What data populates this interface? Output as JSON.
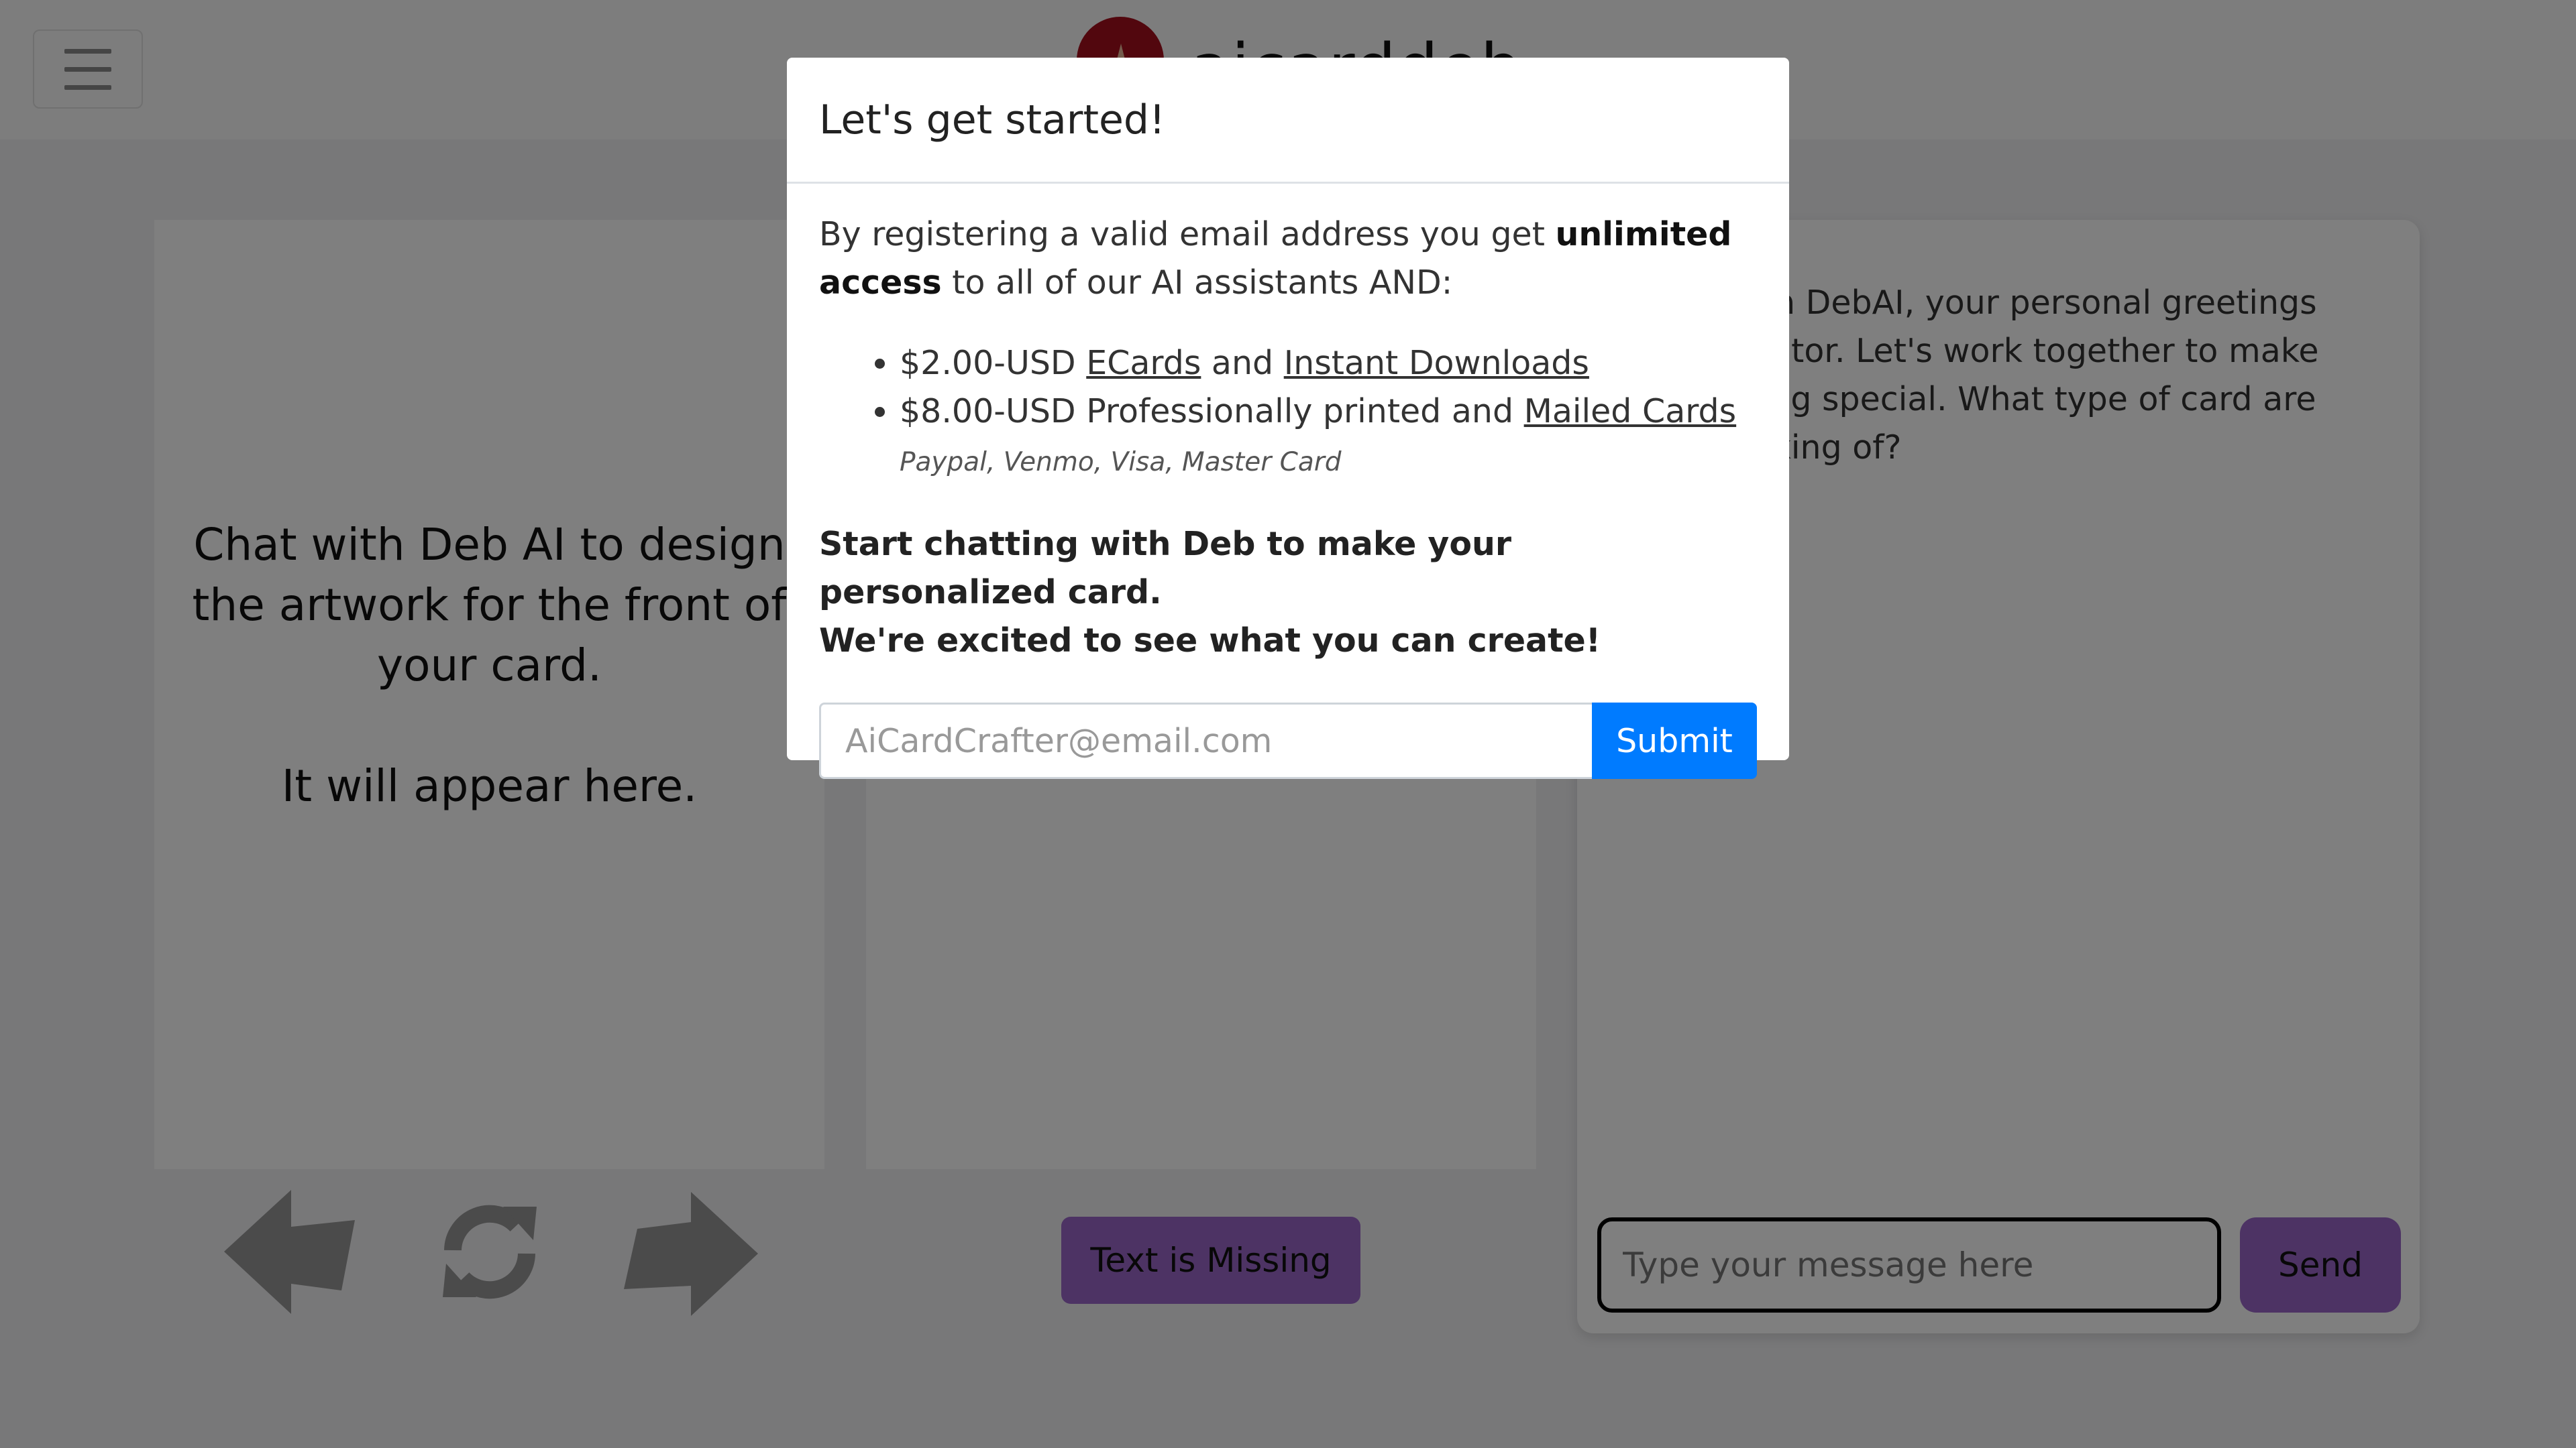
{
  "header": {
    "menu_icon": "hamburger-menu-icon",
    "logo_text": "aicarddeb"
  },
  "card_front": {
    "placeholder_line1": "Chat with Deb AI to design the artwork for the front of your card.",
    "placeholder_line2": "It will appear here."
  },
  "controls": {
    "prev_icon": "arrow-left-icon",
    "regenerate_icon": "refresh-icon",
    "next_icon": "arrow-right-icon",
    "text_missing_label": "Text is Missing"
  },
  "chat": {
    "messages": [
      {
        "sender": "DebAI",
        "text": "Hello! I'm DebAI, your personal greetings card creator. Let's work together to make something special. What type of card are you thinking of?"
      }
    ],
    "input_placeholder": "Type your message here",
    "send_label": "Send"
  },
  "modal": {
    "title": "Let's get started!",
    "intro_pre": "By registering a valid email address you get ",
    "intro_bold": "unlimited access",
    "intro_post": " to all of our AI assistants AND:",
    "offers": [
      {
        "price": "$2.00-USD ",
        "link1": "ECards",
        "mid": " and ",
        "link2": "Instant Downloads"
      },
      {
        "price": "$8.00-USD Professionally printed and ",
        "link1": "Mailed Cards"
      }
    ],
    "payment_methods": "Paypal, Venmo, Visa, Master Card",
    "cta_line1": "Start chatting with Deb to make your personalized card.",
    "cta_line2": "We're excited to see what you can create!",
    "email_placeholder": "AiCardCrafter@email.com",
    "submit_label": "Submit"
  },
  "colors": {
    "primary_button": "#007bff",
    "accent_purple": "#9a66c8",
    "logo_red": "#a50f1d"
  }
}
